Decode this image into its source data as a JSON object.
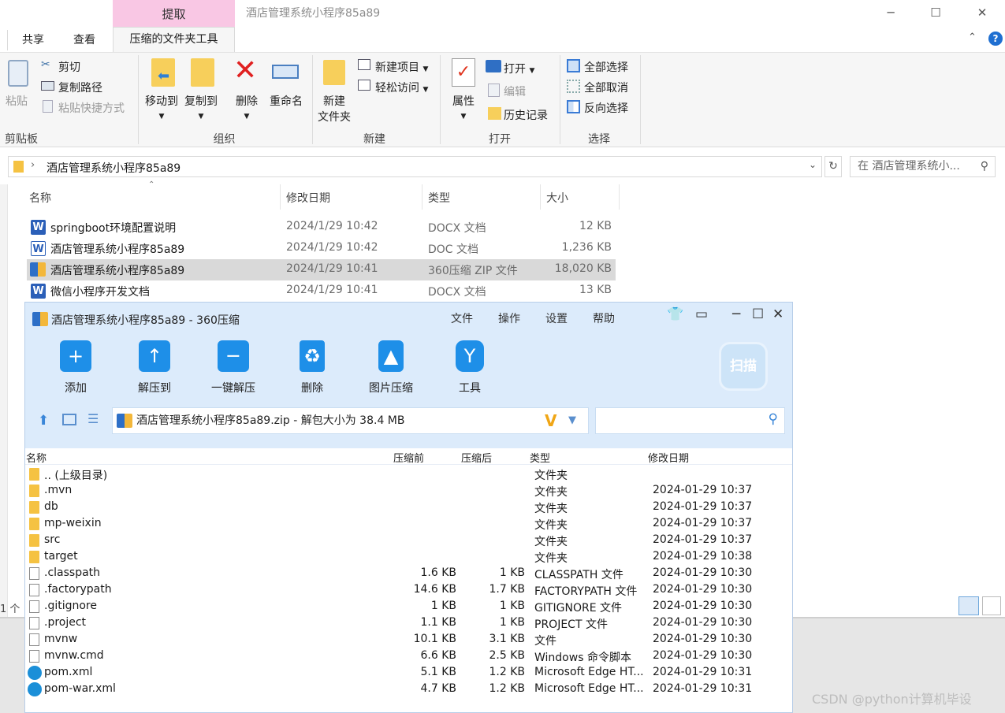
{
  "explorer": {
    "window_title": "酒店管理系统小程序85a89",
    "context_tab": "提取",
    "window_controls": [
      "─",
      "☐",
      "✕"
    ],
    "tabs": [
      "共享",
      "查看",
      "压缩的文件夹工具"
    ],
    "ribbon": {
      "clipboard": {
        "paste": "粘贴",
        "cut": "剪切",
        "copy_path": "复制路径",
        "paste_shortcut": "粘贴快捷方式",
        "label": "剪贴板"
      },
      "organize": {
        "move_to": "移动到",
        "copy_to": "复制到",
        "delete": "删除",
        "rename": "重命名",
        "label": "组织"
      },
      "new": {
        "new_folder_1": "新建",
        "new_folder_2": "文件夹",
        "new_item": "新建项目",
        "easy_access": "轻松访问",
        "label": "新建"
      },
      "open": {
        "properties": "属性",
        "open": "打开",
        "edit": "编辑",
        "history": "历史记录",
        "label": "打开"
      },
      "select": {
        "select_all": "全部选择",
        "select_none": "全部取消",
        "invert": "反向选择",
        "label": "选择"
      }
    },
    "address": "酒店管理系统小程序85a89",
    "search_placeholder": "在 酒店管理系统小...",
    "columns": {
      "name": "名称",
      "date": "修改日期",
      "type": "类型",
      "size": "大小"
    },
    "files": [
      {
        "name": "springboot环境配置说明",
        "date": "2024/1/29 10:42",
        "type": "DOCX 文档",
        "size": "12 KB",
        "icon": "W"
      },
      {
        "name": "酒店管理系统小程序85a89",
        "date": "2024/1/29 10:42",
        "type": "DOC 文档",
        "size": "1,236 KB",
        "icon": "W"
      },
      {
        "name": "酒店管理系统小程序85a89",
        "date": "2024/1/29 10:41",
        "type": "360压缩 ZIP 文件",
        "size": "18,020 KB",
        "icon": "zip"
      },
      {
        "name": "微信小程序开发文档",
        "date": "2024/1/29 10:41",
        "type": "DOCX 文档",
        "size": "13 KB",
        "icon": "W"
      }
    ],
    "status_fragment": "1 个"
  },
  "zip": {
    "title": "酒店管理系统小程序85a89 - 360压缩",
    "menu": [
      "文件",
      "操作",
      "设置",
      "帮助"
    ],
    "tools": [
      "添加",
      "解压到",
      "一键解压",
      "删除",
      "图片压缩",
      "工具"
    ],
    "scan": "扫描",
    "path": "酒店管理系统小程序85a89.zip - 解包大小为 38.4 MB",
    "headers": {
      "name": "名称",
      "before": "压缩前",
      "after": "压缩后",
      "type": "类型",
      "date": "修改日期"
    },
    "rows": [
      {
        "name": ".. (上级目录)",
        "before": "",
        "after": "",
        "type": "文件夹",
        "date": "",
        "icon": "folder"
      },
      {
        "name": ".mvn",
        "before": "",
        "after": "",
        "type": "文件夹",
        "date": "2024-01-29 10:37",
        "icon": "folder"
      },
      {
        "name": "db",
        "before": "",
        "after": "",
        "type": "文件夹",
        "date": "2024-01-29 10:37",
        "icon": "folder"
      },
      {
        "name": "mp-weixin",
        "before": "",
        "after": "",
        "type": "文件夹",
        "date": "2024-01-29 10:37",
        "icon": "folder"
      },
      {
        "name": "src",
        "before": "",
        "after": "",
        "type": "文件夹",
        "date": "2024-01-29 10:37",
        "icon": "folder"
      },
      {
        "name": "target",
        "before": "",
        "after": "",
        "type": "文件夹",
        "date": "2024-01-29 10:38",
        "icon": "folder"
      },
      {
        "name": ".classpath",
        "before": "1.6 KB",
        "after": "1 KB",
        "type": "CLASSPATH 文件",
        "date": "2024-01-29 10:30",
        "icon": "file"
      },
      {
        "name": ".factorypath",
        "before": "14.6 KB",
        "after": "1.7 KB",
        "type": "FACTORYPATH 文件",
        "date": "2024-01-29 10:30",
        "icon": "file"
      },
      {
        "name": ".gitignore",
        "before": "1 KB",
        "after": "1 KB",
        "type": "GITIGNORE 文件",
        "date": "2024-01-29 10:30",
        "icon": "file"
      },
      {
        "name": ".project",
        "before": "1.1 KB",
        "after": "1 KB",
        "type": "PROJECT 文件",
        "date": "2024-01-29 10:30",
        "icon": "file"
      },
      {
        "name": "mvnw",
        "before": "10.1 KB",
        "after": "3.1 KB",
        "type": "文件",
        "date": "2024-01-29 10:30",
        "icon": "file"
      },
      {
        "name": "mvnw.cmd",
        "before": "6.6 KB",
        "after": "2.5 KB",
        "type": "Windows 命令脚本",
        "date": "2024-01-29 10:30",
        "icon": "file"
      },
      {
        "name": "pom.xml",
        "before": "5.1 KB",
        "after": "1.2 KB",
        "type": "Microsoft Edge HT...",
        "date": "2024-01-29 10:31",
        "icon": "edge"
      },
      {
        "name": "pom-war.xml",
        "before": "4.7 KB",
        "after": "1.2 KB",
        "type": "Microsoft Edge HT...",
        "date": "2024-01-29 10:31",
        "icon": "edge"
      }
    ]
  },
  "watermark": "CSDN @python计算机毕设"
}
